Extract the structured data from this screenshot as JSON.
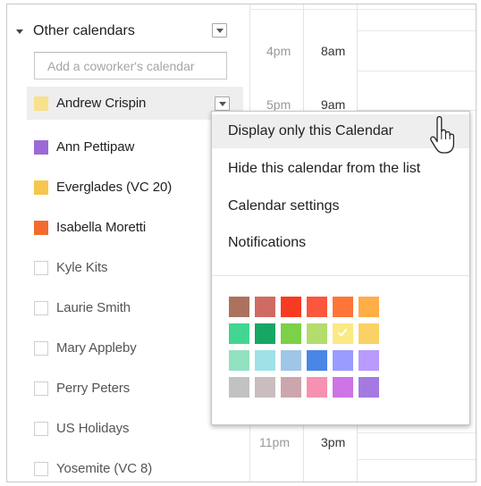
{
  "other_calendars": {
    "title": "Other calendars",
    "coworker_placeholder": "Add a coworker's calendar",
    "items": [
      {
        "label": "Andrew Crispin",
        "color": "#f8e18a",
        "checked": true
      },
      {
        "label": "Ann Pettipaw",
        "color": "#9b6ad6",
        "checked": true
      },
      {
        "label": "Everglades (VC 20)",
        "color": "#f6c64d",
        "checked": true
      },
      {
        "label": "Isabella Moretti",
        "color": "#f26a2e",
        "checked": true
      },
      {
        "label": "Kyle Kits",
        "color": null,
        "checked": false
      },
      {
        "label": "Laurie Smith",
        "color": null,
        "checked": false
      },
      {
        "label": "Mary Appleby",
        "color": null,
        "checked": false
      },
      {
        "label": "Perry Peters",
        "color": null,
        "checked": false
      },
      {
        "label": "US Holidays",
        "color": null,
        "checked": false
      },
      {
        "label": "Yosemite (VC 8)",
        "color": null,
        "checked": false
      }
    ]
  },
  "time_grid": {
    "rows": [
      {
        "tz1": "4pm",
        "tz2": "8am"
      },
      {
        "tz1": "5pm",
        "tz2": "9am"
      },
      {
        "tz1": "11pm",
        "tz2": "3pm"
      }
    ]
  },
  "menu": {
    "items": [
      {
        "label": "Display only this Calendar"
      },
      {
        "label": "Hide this calendar from the list"
      },
      {
        "label": "Calendar settings"
      },
      {
        "label": "Notifications"
      }
    ],
    "palette": [
      "#ac725e",
      "#d06b64",
      "#f83a22",
      "#fa573c",
      "#ff7537",
      "#ffad46",
      "#42d692",
      "#16a765",
      "#7bd148",
      "#b3dc6c",
      "#fbe983",
      "#fad165",
      "#92e1c0",
      "#9fe1e7",
      "#9fc6e7",
      "#4986e7",
      "#9a9cff",
      "#b99aff",
      "#c2c2c2",
      "#cabdbf",
      "#cca6ac",
      "#f691b2",
      "#cd74e6",
      "#a47ae2"
    ],
    "selected_color_index": 10
  }
}
